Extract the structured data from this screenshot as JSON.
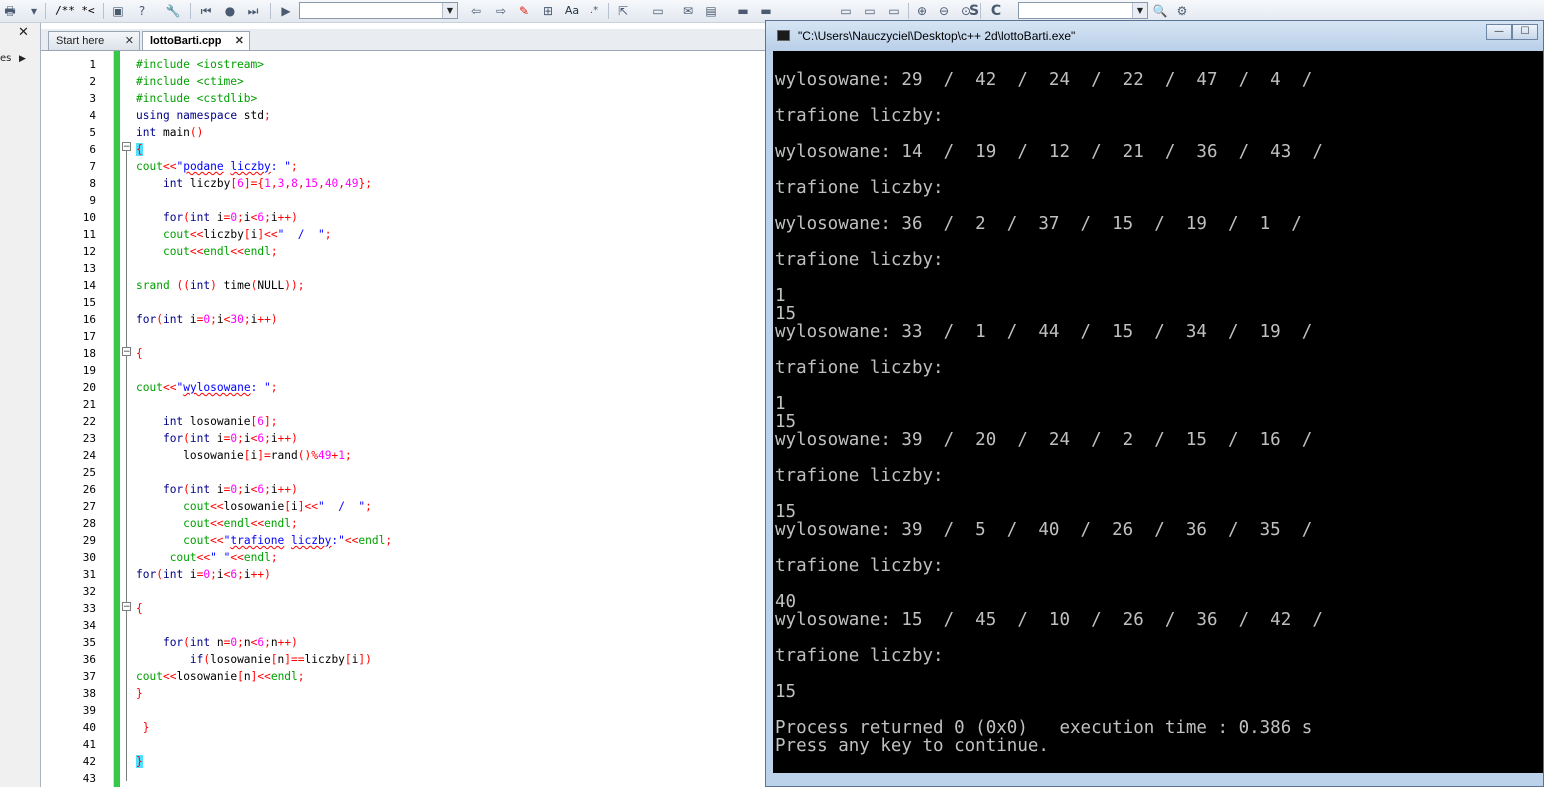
{
  "toolbar": {
    "icons": [
      "print-icon",
      "dropdown-icon",
      "comment-icon",
      "uncomment-icon",
      "build-icon",
      "help-icon",
      "wrench-icon",
      "back-icon",
      "record-icon",
      "forward-icon",
      "play-icon",
      "search-combo",
      "undo-icon",
      "redo-icon",
      "highlight-icon",
      "replace-icon",
      "font-icon",
      "regex-icon",
      "cursor-icon",
      "panel-icons",
      "zoom-in-icon",
      "zoom-out-icon",
      "zoom-reset-icon",
      "s-icon",
      "c-icon",
      "symbol-combo",
      "find-icon",
      "settings-icon"
    ],
    "comment_label": "/**",
    "uncomment_label": "*<"
  },
  "left_panel": {
    "close_label": "✕",
    "tab_label": "es"
  },
  "tabs": [
    {
      "label": "Start here",
      "active": false
    },
    {
      "label": "lottoBarti.cpp",
      "active": true
    }
  ],
  "editor": {
    "line_numbers": [
      "1",
      "2",
      "3",
      "4",
      "5",
      "6",
      "7",
      "8",
      "9",
      "10",
      "11",
      "12",
      "13",
      "14",
      "15",
      "16",
      "17",
      "18",
      "19",
      "20",
      "21",
      "22",
      "23",
      "24",
      "25",
      "26",
      "27",
      "28",
      "29",
      "30",
      "31",
      "32",
      "33",
      "34",
      "35",
      "36",
      "37",
      "38",
      "39",
      "40",
      "41",
      "42",
      "43"
    ],
    "lines": [
      "#include <iostream>",
      "#include <ctime>",
      "#include <cstdlib>",
      "using namespace std;",
      "int main()",
      "{",
      "cout<<\"podane liczby: \";",
      "    int liczby[6]={1,3,8,15,40,49};",
      "",
      "    for(int i=0;i<6;i++)",
      "    cout<<liczby[i]<<\"  /  \";",
      "    cout<<endl<<endl;",
      "",
      "srand ((int) time(NULL));",
      "",
      "for(int i=0;i<30;i++)",
      "",
      "{",
      "",
      "cout<<\"wylosowane: \";",
      "",
      "    int losowanie[6];",
      "    for(int i=0;i<6;i++)",
      "       losowanie[i]=rand()%49+1;",
      "",
      "    for(int i=0;i<6;i++)",
      "       cout<<losowanie[i]<<\"  /  \";",
      "       cout<<endl<<endl;",
      "       cout<<\"trafione liczby:\"<<endl;",
      "     cout<<\" \"<<endl;",
      "for(int i=0;i<6;i++)",
      "",
      "{",
      "",
      "    for(int n=0;n<6;n++)",
      "        if(losowanie[n]==liczby[i])",
      "cout<<losowanie[n]<<endl;",
      "}",
      "",
      " }",
      "",
      "}",
      ""
    ]
  },
  "console": {
    "title": "\"C:\\Users\\Nauczyciel\\Desktop\\c++ 2d\\lottoBarti.exe\"",
    "minimize_label": "—",
    "maximize_label": "☐",
    "output": [
      "wylosowane: 29  /  42  /  24  /  22  /  47  /  4  /",
      "",
      "trafione liczby:",
      "",
      "wylosowane: 14  /  19  /  12  /  21  /  36  /  43  /",
      "",
      "trafione liczby:",
      "",
      "wylosowane: 36  /  2  /  37  /  15  /  19  /  1  /",
      "",
      "trafione liczby:",
      "",
      "1",
      "15",
      "wylosowane: 33  /  1  /  44  /  15  /  34  /  19  /",
      "",
      "trafione liczby:",
      "",
      "1",
      "15",
      "wylosowane: 39  /  20  /  24  /  2  /  15  /  16  /",
      "",
      "trafione liczby:",
      "",
      "15",
      "wylosowane: 39  /  5  /  40  /  26  /  36  /  35  /",
      "",
      "trafione liczby:",
      "",
      "40",
      "wylosowane: 15  /  45  /  10  /  26  /  36  /  42  /",
      "",
      "trafione liczby:",
      "",
      "15",
      "",
      "Process returned 0 (0x0)   execution time : 0.386 s",
      "Press any key to continue."
    ]
  }
}
